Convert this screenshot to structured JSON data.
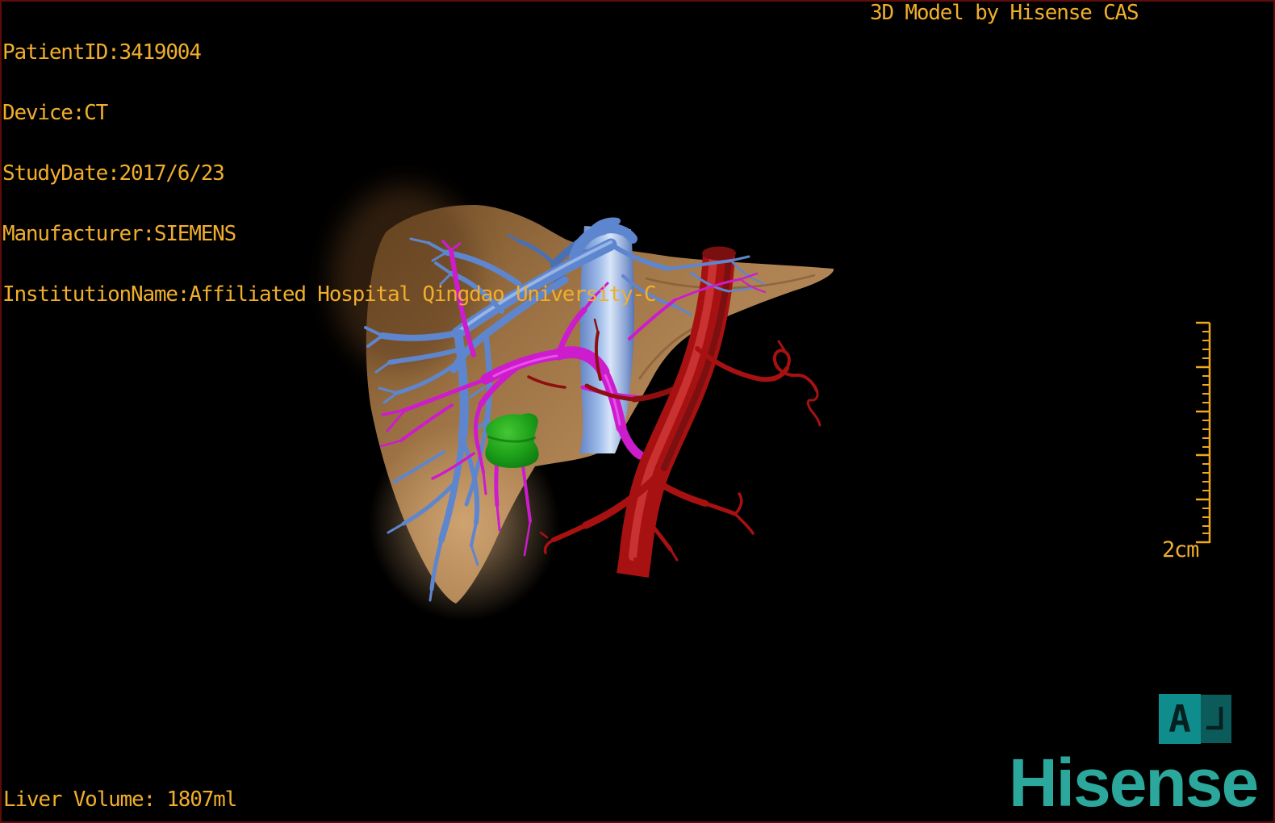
{
  "header": {
    "patient_info_lines": [
      "PatientID:3419004",
      "Device:CT",
      "StudyDate:2017/6/23",
      "Manufacturer:SIEMENS",
      "InstitutionName:Affiliated Hospital Qingdao University-C"
    ],
    "watermark": "3D Model by Hisense CAS"
  },
  "footer": {
    "liver_volume": "Liver Volume: 1807ml",
    "brand_logo": "Hisense"
  },
  "scale_bar": {
    "label": "2cm"
  },
  "orientation": {
    "letter": "A"
  },
  "model": {
    "colors": {
      "liver": "#a87c4e",
      "portal_vein": "#5e86ce",
      "portal_vein_shadow": "#4a70b4",
      "vena_cava": "#a9c6f0",
      "hepatic_artery": "#a81111",
      "artery_dark": "#8e0f0f",
      "bile_duct": "#cc1ccc",
      "gallbladder": "#1fa31a",
      "overlay_text": "#f1ae2c",
      "brand_teal": "#2ba89b"
    }
  }
}
